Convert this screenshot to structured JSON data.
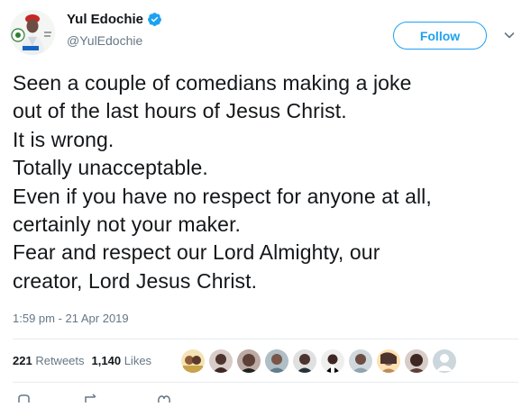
{
  "tweet": {
    "author": {
      "display_name": "Yul Edochie",
      "handle": "@YulEdochie",
      "verified": true,
      "avatar_icon": "profile-photo"
    },
    "follow_label": "Follow",
    "text_lines": [
      "Seen a couple of comedians making a joke",
      "out of the last hours of Jesus Christ.",
      "It is wrong.",
      "Totally unacceptable.",
      "Even if you have no respect for anyone at all,",
      "certainly not your maker.",
      "Fear and respect our Lord Almighty, our",
      "creator, Lord Jesus Christ."
    ],
    "timestamp": "1:59 pm - 21 Apr 2019",
    "stats": {
      "retweets_count": "221",
      "retweets_label": "Retweets",
      "likes_count": "1,140",
      "likes_label": "Likes"
    },
    "likers_count_shown": 10
  },
  "colors": {
    "accent": "#1da1f2",
    "text": "#14171a",
    "muted": "#657786",
    "divider": "#e6ecf0"
  }
}
